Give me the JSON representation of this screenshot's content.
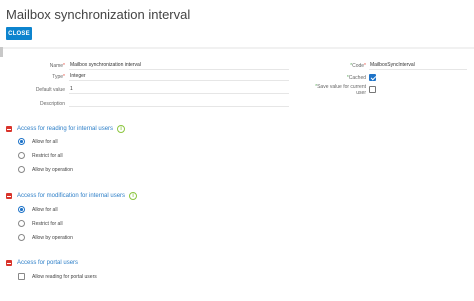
{
  "header": {
    "title": "Mailbox synchronization interval",
    "close_label": "CLOSE"
  },
  "fields": {
    "name": {
      "label": "Name",
      "value": "Mailbox synchronization interval"
    },
    "type": {
      "label": "Type",
      "value": "Integer"
    },
    "default_value": {
      "label": "Default value",
      "value": "1"
    },
    "description": {
      "label": "Description",
      "value": ""
    },
    "code": {
      "label": "Code",
      "value": "MailboxSyncInterval"
    },
    "cached": {
      "label": "Cached",
      "checked": true
    },
    "save_value": {
      "label_line1": "Save value for current",
      "label_line2": "user",
      "checked": false
    }
  },
  "sections": [
    {
      "title": "Access for reading for internal users",
      "options": [
        {
          "label": "Allow for all",
          "selected": true
        },
        {
          "label": "Restrict for all",
          "selected": false
        },
        {
          "label": "Allow by operation",
          "selected": false
        }
      ]
    },
    {
      "title": "Access for modification for internal users",
      "options": [
        {
          "label": "Allow for all",
          "selected": true
        },
        {
          "label": "Restrict for all",
          "selected": false
        },
        {
          "label": "Allow by operation",
          "selected": false
        }
      ]
    },
    {
      "title": "Access for portal users",
      "checkbox": {
        "label": "Allow reading for portal users",
        "checked": false
      }
    }
  ],
  "colors": {
    "accent": "#0d84ce",
    "section_title": "#2d7fc8",
    "collapse_icon": "#d9342b",
    "info_icon": "#8cc63f"
  }
}
